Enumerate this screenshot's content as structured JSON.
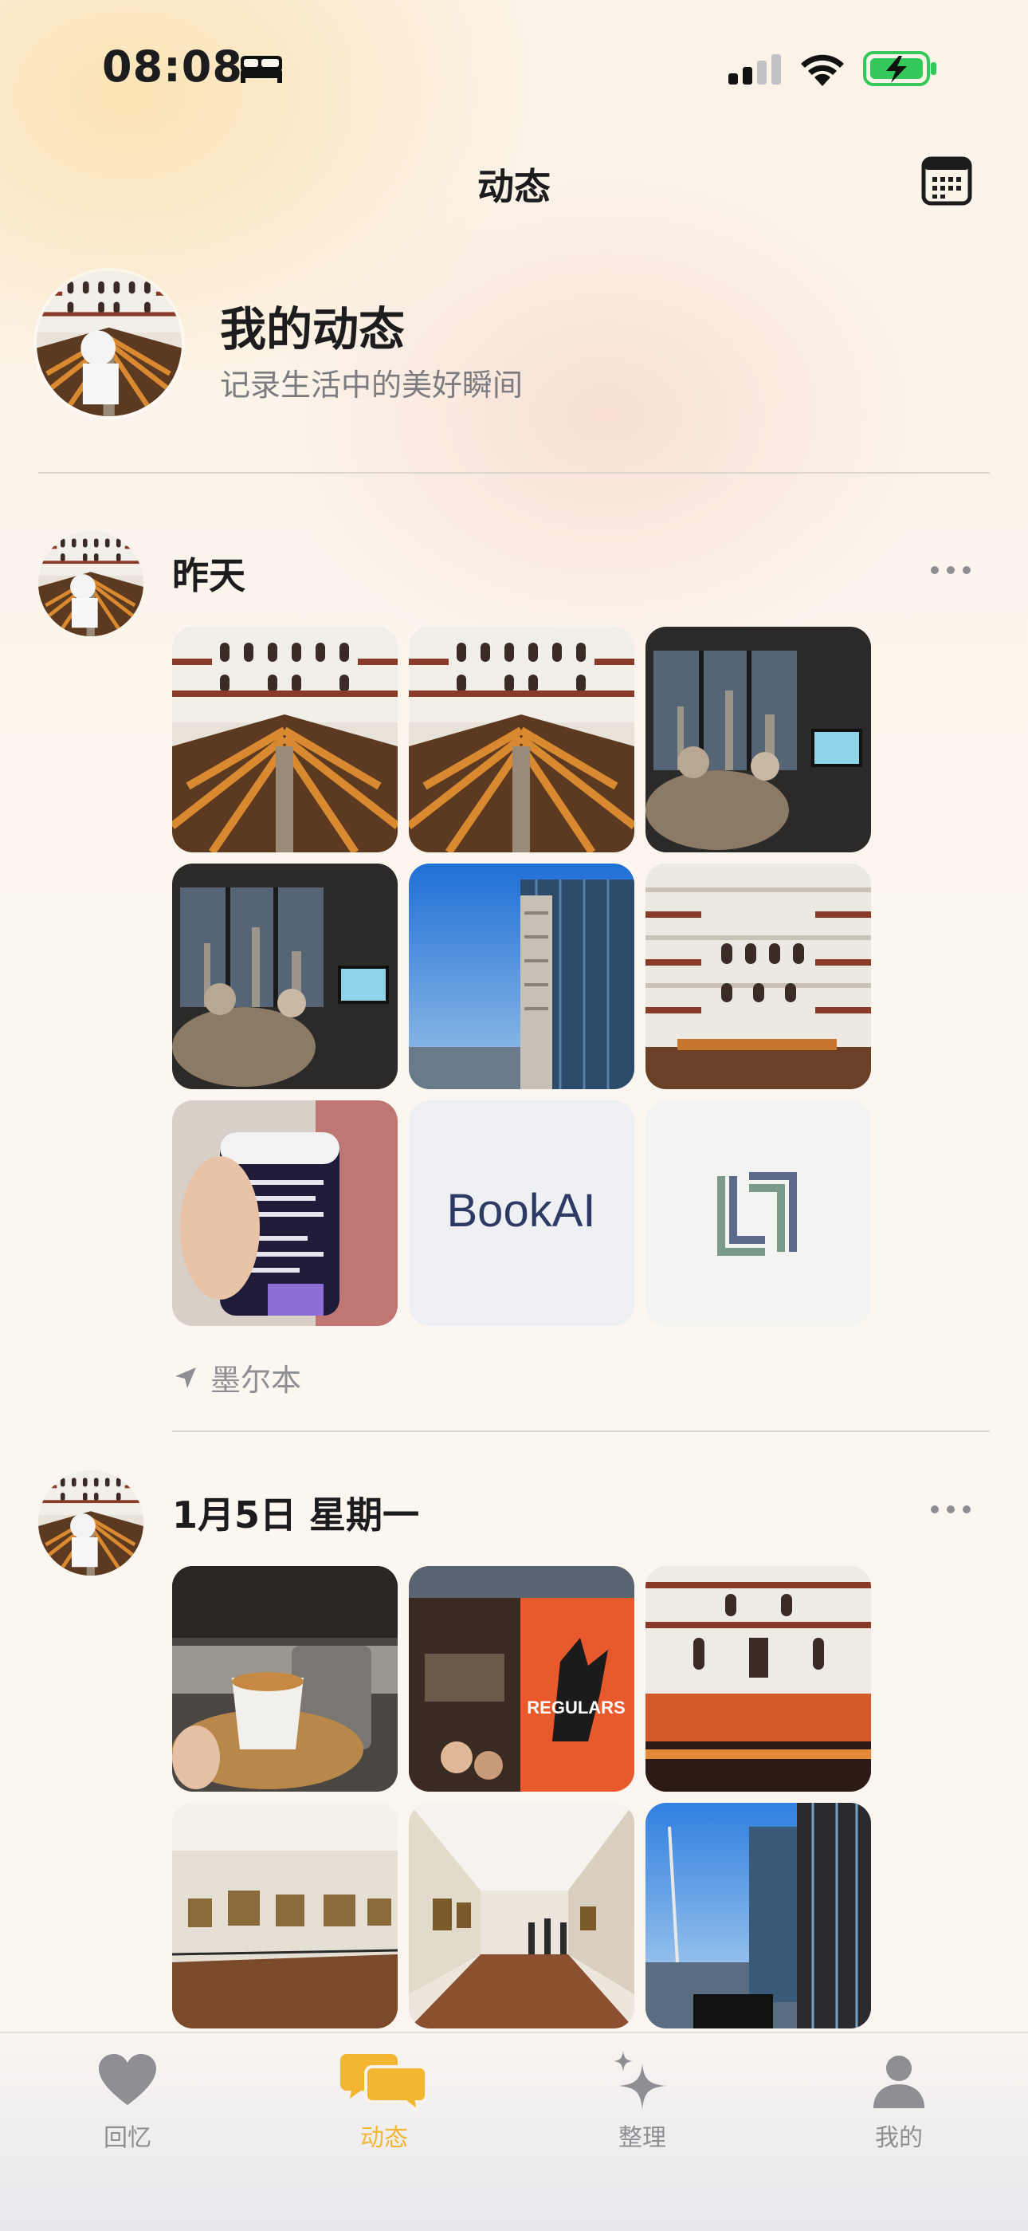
{
  "status_bar": {
    "time": "08:08",
    "focus_icon": "bed-icon",
    "signal_icon": "cellular-signal-icon",
    "wifi_icon": "wifi-icon",
    "battery_icon": "battery-charging-icon",
    "battery_color": "#34c759"
  },
  "header": {
    "title": "动态",
    "calendar_icon": "calendar-icon"
  },
  "profile": {
    "title": "我的动态",
    "subtitle": "记录生活中的美好瞬间"
  },
  "posts": [
    {
      "date": "昨天",
      "photo_count": 9,
      "photos": [
        "library-reading-room",
        "library-reading-room",
        "skyline-window-tv",
        "skyline-window-tv",
        "skyscraper-blue-sky",
        "library-domed-hall",
        "supplement-container",
        "bookai-logo",
        "geometric-logo"
      ],
      "logo_texts": [
        "BookAI"
      ],
      "location": "墨尔本"
    },
    {
      "date": "1月5日 星期一",
      "photos": [
        "coffee-cup",
        "regulars-storefront",
        "library-gallery",
        "art-gallery",
        "art-gallery-corridor",
        "city-view-window"
      ],
      "logo_texts": [
        "REGULARS"
      ]
    }
  ],
  "tab_bar": {
    "accent_color": "#f2b632",
    "tabs": [
      {
        "label": "回忆",
        "icon": "heart-icon",
        "active": false
      },
      {
        "label": "动态",
        "icon": "chat-bubbles-icon",
        "active": true
      },
      {
        "label": "整理",
        "icon": "sparkles-icon",
        "active": false
      },
      {
        "label": "我的",
        "icon": "person-icon",
        "active": false
      }
    ]
  }
}
